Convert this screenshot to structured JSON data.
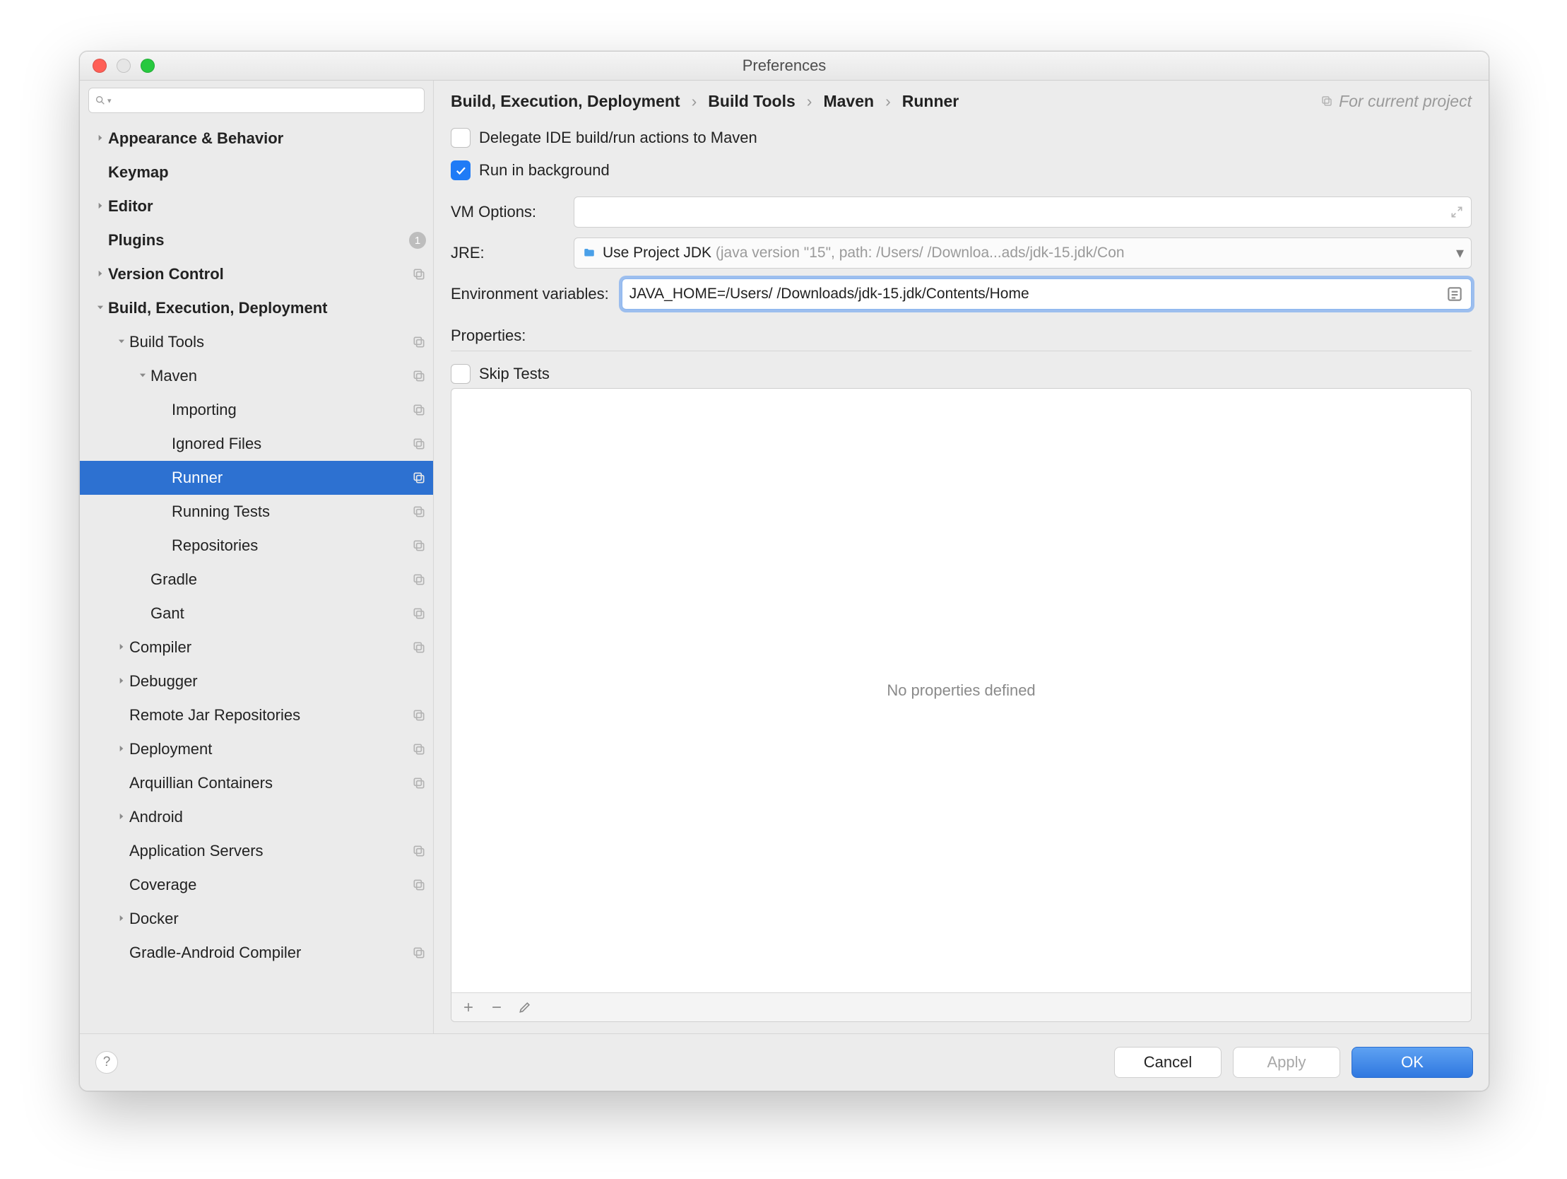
{
  "window": {
    "title": "Preferences"
  },
  "sidebar": {
    "items": [
      {
        "label": "Appearance & Behavior",
        "indent": 0,
        "arrow": "right",
        "bold": true
      },
      {
        "label": "Keymap",
        "indent": 0,
        "arrow": "none",
        "bold": true
      },
      {
        "label": "Editor",
        "indent": 0,
        "arrow": "right",
        "bold": true
      },
      {
        "label": "Plugins",
        "indent": 0,
        "arrow": "none",
        "bold": true,
        "count": "1"
      },
      {
        "label": "Version Control",
        "indent": 0,
        "arrow": "right",
        "bold": true,
        "copy": true
      },
      {
        "label": "Build, Execution, Deployment",
        "indent": 0,
        "arrow": "down",
        "bold": true
      },
      {
        "label": "Build Tools",
        "indent": 1,
        "arrow": "down",
        "copy": true
      },
      {
        "label": "Maven",
        "indent": 2,
        "arrow": "down",
        "copy": true
      },
      {
        "label": "Importing",
        "indent": 3,
        "arrow": "none",
        "copy": true
      },
      {
        "label": "Ignored Files",
        "indent": 3,
        "arrow": "none",
        "copy": true
      },
      {
        "label": "Runner",
        "indent": 3,
        "arrow": "none",
        "copy": true,
        "selected": true
      },
      {
        "label": "Running Tests",
        "indent": 3,
        "arrow": "none",
        "copy": true
      },
      {
        "label": "Repositories",
        "indent": 3,
        "arrow": "none",
        "copy": true
      },
      {
        "label": "Gradle",
        "indent": 2,
        "arrow": "none",
        "copy": true
      },
      {
        "label": "Gant",
        "indent": 2,
        "arrow": "none",
        "copy": true
      },
      {
        "label": "Compiler",
        "indent": 1,
        "arrow": "right",
        "copy": true
      },
      {
        "label": "Debugger",
        "indent": 1,
        "arrow": "right"
      },
      {
        "label": "Remote Jar Repositories",
        "indent": 1,
        "arrow": "none",
        "copy": true
      },
      {
        "label": "Deployment",
        "indent": 1,
        "arrow": "right",
        "copy": true
      },
      {
        "label": "Arquillian Containers",
        "indent": 1,
        "arrow": "none",
        "copy": true
      },
      {
        "label": "Android",
        "indent": 1,
        "arrow": "right"
      },
      {
        "label": "Application Servers",
        "indent": 1,
        "arrow": "none",
        "copy": true
      },
      {
        "label": "Coverage",
        "indent": 1,
        "arrow": "none",
        "copy": true
      },
      {
        "label": "Docker",
        "indent": 1,
        "arrow": "right"
      },
      {
        "label": "Gradle-Android Compiler",
        "indent": 1,
        "arrow": "none",
        "copy": true
      }
    ]
  },
  "breadcrumb": {
    "a": "Build, Execution, Deployment",
    "b": "Build Tools",
    "c": "Maven",
    "d": "Runner",
    "project_scope": "For current project"
  },
  "form": {
    "delegate_label": "Delegate IDE build/run actions to Maven",
    "run_bg_label": "Run in background",
    "vm_label": "VM Options:",
    "vm_value": "",
    "jre_label": "JRE:",
    "jre_prefix": "Use Project JDK",
    "jre_gray": " (java version \"15\", path: /Users/                    /Downloa...ads/jdk-15.jdk/Con",
    "env_label": "Environment variables:",
    "env_value": "JAVA_HOME=/Users/                   /Downloads/jdk-15.jdk/Contents/Home",
    "properties_label": "Properties:",
    "skip_tests_label": "Skip Tests",
    "no_props": "No properties defined"
  },
  "footer": {
    "cancel": "Cancel",
    "apply": "Apply",
    "ok": "OK"
  }
}
